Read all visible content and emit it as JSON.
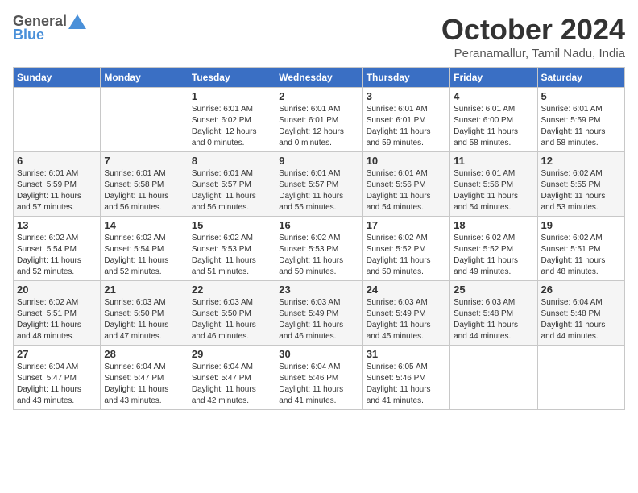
{
  "header": {
    "logo": {
      "general": "General",
      "blue": "Blue",
      "icon": "▶"
    },
    "title": "October 2024",
    "subtitle": "Peranamallur, Tamil Nadu, India"
  },
  "calendar": {
    "days_of_week": [
      "Sunday",
      "Monday",
      "Tuesday",
      "Wednesday",
      "Thursday",
      "Friday",
      "Saturday"
    ],
    "weeks": [
      [
        {
          "day": "",
          "info": ""
        },
        {
          "day": "",
          "info": ""
        },
        {
          "day": "1",
          "info": "Sunrise: 6:01 AM\nSunset: 6:02 PM\nDaylight: 12 hours\nand 0 minutes."
        },
        {
          "day": "2",
          "info": "Sunrise: 6:01 AM\nSunset: 6:01 PM\nDaylight: 12 hours\nand 0 minutes."
        },
        {
          "day": "3",
          "info": "Sunrise: 6:01 AM\nSunset: 6:01 PM\nDaylight: 11 hours\nand 59 minutes."
        },
        {
          "day": "4",
          "info": "Sunrise: 6:01 AM\nSunset: 6:00 PM\nDaylight: 11 hours\nand 58 minutes."
        },
        {
          "day": "5",
          "info": "Sunrise: 6:01 AM\nSunset: 5:59 PM\nDaylight: 11 hours\nand 58 minutes."
        }
      ],
      [
        {
          "day": "6",
          "info": "Sunrise: 6:01 AM\nSunset: 5:59 PM\nDaylight: 11 hours\nand 57 minutes."
        },
        {
          "day": "7",
          "info": "Sunrise: 6:01 AM\nSunset: 5:58 PM\nDaylight: 11 hours\nand 56 minutes."
        },
        {
          "day": "8",
          "info": "Sunrise: 6:01 AM\nSunset: 5:57 PM\nDaylight: 11 hours\nand 56 minutes."
        },
        {
          "day": "9",
          "info": "Sunrise: 6:01 AM\nSunset: 5:57 PM\nDaylight: 11 hours\nand 55 minutes."
        },
        {
          "day": "10",
          "info": "Sunrise: 6:01 AM\nSunset: 5:56 PM\nDaylight: 11 hours\nand 54 minutes."
        },
        {
          "day": "11",
          "info": "Sunrise: 6:01 AM\nSunset: 5:56 PM\nDaylight: 11 hours\nand 54 minutes."
        },
        {
          "day": "12",
          "info": "Sunrise: 6:02 AM\nSunset: 5:55 PM\nDaylight: 11 hours\nand 53 minutes."
        }
      ],
      [
        {
          "day": "13",
          "info": "Sunrise: 6:02 AM\nSunset: 5:54 PM\nDaylight: 11 hours\nand 52 minutes."
        },
        {
          "day": "14",
          "info": "Sunrise: 6:02 AM\nSunset: 5:54 PM\nDaylight: 11 hours\nand 52 minutes."
        },
        {
          "day": "15",
          "info": "Sunrise: 6:02 AM\nSunset: 5:53 PM\nDaylight: 11 hours\nand 51 minutes."
        },
        {
          "day": "16",
          "info": "Sunrise: 6:02 AM\nSunset: 5:53 PM\nDaylight: 11 hours\nand 50 minutes."
        },
        {
          "day": "17",
          "info": "Sunrise: 6:02 AM\nSunset: 5:52 PM\nDaylight: 11 hours\nand 50 minutes."
        },
        {
          "day": "18",
          "info": "Sunrise: 6:02 AM\nSunset: 5:52 PM\nDaylight: 11 hours\nand 49 minutes."
        },
        {
          "day": "19",
          "info": "Sunrise: 6:02 AM\nSunset: 5:51 PM\nDaylight: 11 hours\nand 48 minutes."
        }
      ],
      [
        {
          "day": "20",
          "info": "Sunrise: 6:02 AM\nSunset: 5:51 PM\nDaylight: 11 hours\nand 48 minutes."
        },
        {
          "day": "21",
          "info": "Sunrise: 6:03 AM\nSunset: 5:50 PM\nDaylight: 11 hours\nand 47 minutes."
        },
        {
          "day": "22",
          "info": "Sunrise: 6:03 AM\nSunset: 5:50 PM\nDaylight: 11 hours\nand 46 minutes."
        },
        {
          "day": "23",
          "info": "Sunrise: 6:03 AM\nSunset: 5:49 PM\nDaylight: 11 hours\nand 46 minutes."
        },
        {
          "day": "24",
          "info": "Sunrise: 6:03 AM\nSunset: 5:49 PM\nDaylight: 11 hours\nand 45 minutes."
        },
        {
          "day": "25",
          "info": "Sunrise: 6:03 AM\nSunset: 5:48 PM\nDaylight: 11 hours\nand 44 minutes."
        },
        {
          "day": "26",
          "info": "Sunrise: 6:04 AM\nSunset: 5:48 PM\nDaylight: 11 hours\nand 44 minutes."
        }
      ],
      [
        {
          "day": "27",
          "info": "Sunrise: 6:04 AM\nSunset: 5:47 PM\nDaylight: 11 hours\nand 43 minutes."
        },
        {
          "day": "28",
          "info": "Sunrise: 6:04 AM\nSunset: 5:47 PM\nDaylight: 11 hours\nand 43 minutes."
        },
        {
          "day": "29",
          "info": "Sunrise: 6:04 AM\nSunset: 5:47 PM\nDaylight: 11 hours\nand 42 minutes."
        },
        {
          "day": "30",
          "info": "Sunrise: 6:04 AM\nSunset: 5:46 PM\nDaylight: 11 hours\nand 41 minutes."
        },
        {
          "day": "31",
          "info": "Sunrise: 6:05 AM\nSunset: 5:46 PM\nDaylight: 11 hours\nand 41 minutes."
        },
        {
          "day": "",
          "info": ""
        },
        {
          "day": "",
          "info": ""
        }
      ]
    ]
  }
}
